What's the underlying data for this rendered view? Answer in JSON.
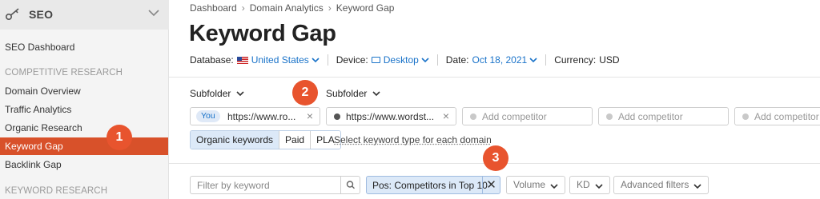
{
  "sidebar": {
    "title": "SEO",
    "items": [
      {
        "label": "SEO Dashboard"
      },
      {
        "label": "Domain Overview"
      },
      {
        "label": "Traffic Analytics"
      },
      {
        "label": "Organic Research"
      },
      {
        "label": "Keyword Gap",
        "active": true
      },
      {
        "label": "Backlink Gap"
      }
    ],
    "sections": [
      "COMPETITIVE RESEARCH",
      "KEYWORD RESEARCH"
    ]
  },
  "breadcrumb": [
    "Dashboard",
    "Domain Analytics",
    "Keyword Gap"
  ],
  "page_title": "Keyword Gap",
  "meta": {
    "database_label": "Database:",
    "database_value": "United States",
    "device_label": "Device:",
    "device_value": "Desktop",
    "date_label": "Date:",
    "date_value": "Oct 18, 2021",
    "currency_label": "Currency:",
    "currency_value": "USD"
  },
  "subfolder_label": "Subfolder",
  "domains": {
    "you_badge": "You",
    "first": "https://www.ro...",
    "second": "https://www.wordst...",
    "add_placeholder": "Add competitor"
  },
  "keyword_types": [
    "Organic keywords",
    "Paid",
    "PLA"
  ],
  "keyword_type_hint": "Select keyword type for each domain",
  "filters": {
    "search_placeholder": "Filter by keyword",
    "active_chip": "Pos: Competitors in Top 10",
    "volume": "Volume",
    "kd": "KD",
    "advanced": "Advanced filters"
  },
  "badges": [
    "1",
    "2",
    "3"
  ],
  "colors": {
    "accent": "#d8512a",
    "link": "#1a73c9",
    "badge": "#e8542e"
  }
}
